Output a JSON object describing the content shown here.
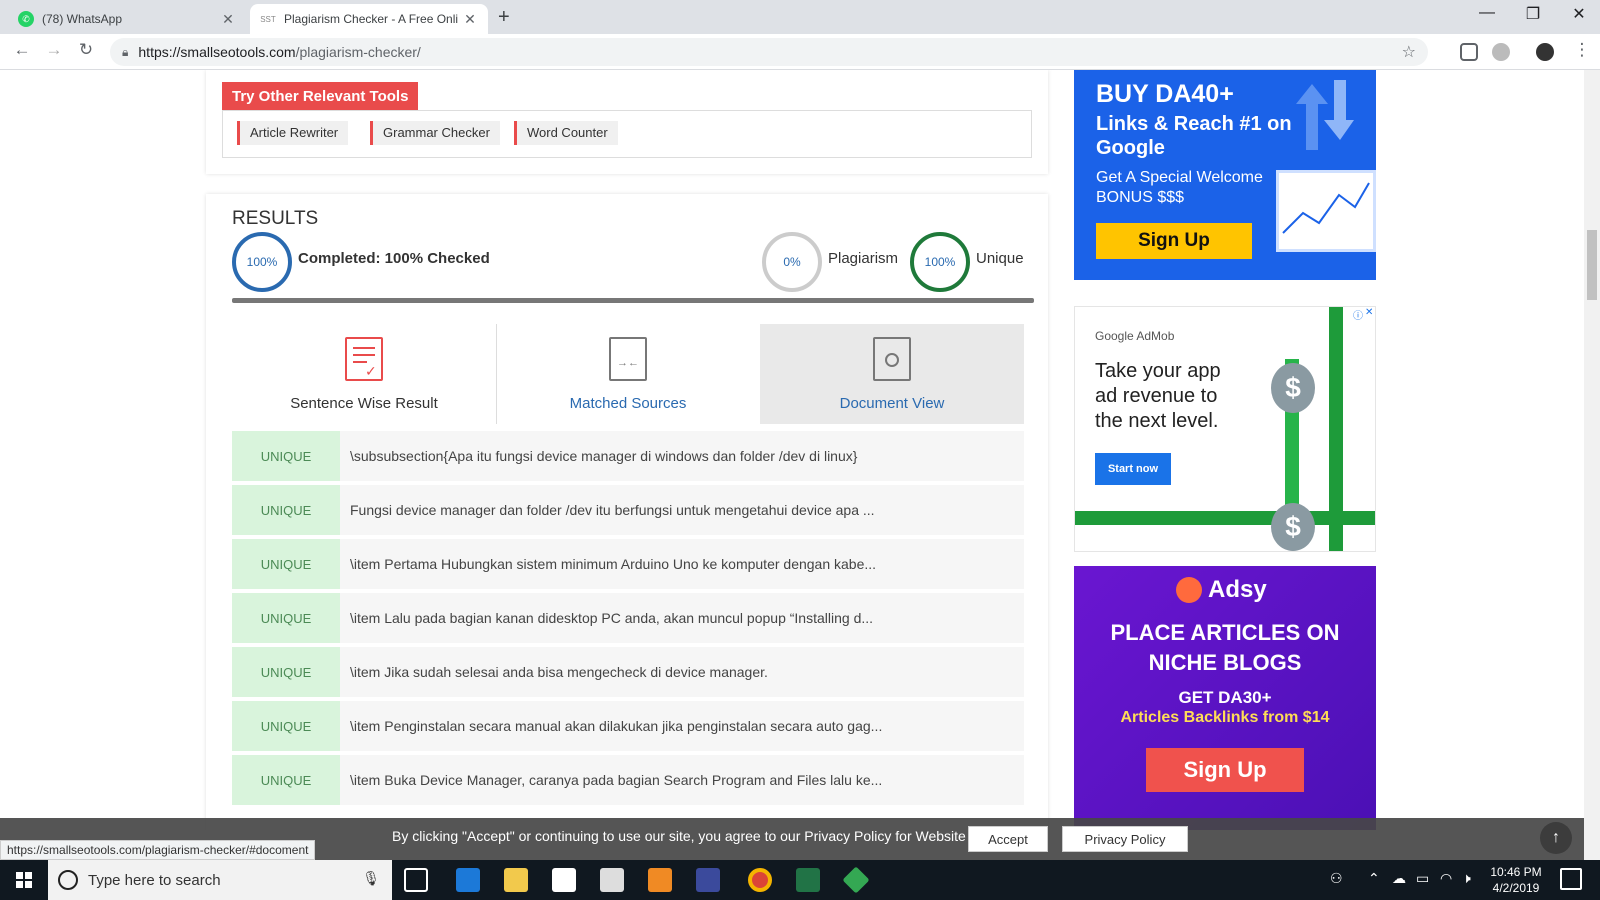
{
  "browser": {
    "tabs": [
      {
        "title": "(78) WhatsApp",
        "active": false
      },
      {
        "title": "Plagiarism Checker - A Free Onli",
        "active": true
      }
    ],
    "url_host": "https://smallseotools.com",
    "url_path": "/plagiarism-checker/",
    "status_url": "https://smallseotools.com/plagiarism-checker/#docoment"
  },
  "tools": {
    "heading": "Try Other Relevant Tools",
    "items": [
      "Article Rewriter",
      "Grammar Checker",
      "Word Counter"
    ]
  },
  "results": {
    "title": "RESULTS",
    "completed_pct": "100%",
    "completed_label": "Completed: 100% Checked",
    "plagiarism_pct": "0%",
    "plagiarism_label": "Plagiarism",
    "unique_pct": "100%",
    "unique_label": "Unique",
    "tabs": [
      "Sentence Wise Result",
      "Matched Sources",
      "Document View"
    ],
    "rows": [
      {
        "status": "UNIQUE",
        "text": "\\subsubsection{Apa itu fungsi device manager di windows dan folder /dev di linux}"
      },
      {
        "status": "UNIQUE",
        "text": "Fungsi device manager dan folder /dev itu berfungsi untuk mengetahui device apa ..."
      },
      {
        "status": "UNIQUE",
        "text": "\\item Pertama Hubungkan sistem minimum Arduino Uno ke komputer dengan kabe..."
      },
      {
        "status": "UNIQUE",
        "text": "\\item Lalu pada bagian kanan didesktop PC anda, akan muncul popup “Installing d..."
      },
      {
        "status": "UNIQUE",
        "text": "\\item Jika sudah selesai anda bisa mengecheck di device manager."
      },
      {
        "status": "UNIQUE",
        "text": "\\item Penginstalan secara manual akan dilakukan jika penginstalan secara auto gag..."
      },
      {
        "status": "UNIQUE",
        "text": "\\item Buka Device Manager, caranya pada bagian Search Program and Files lalu ke..."
      }
    ]
  },
  "ads": {
    "ad1": {
      "line1": "BUY DA40+",
      "line2": "Links & Reach #1 on Google",
      "line3": "Get A Special Welcome BONUS $$$",
      "button": "Sign Up"
    },
    "ad2": {
      "brand": "Google AdMob",
      "headline": "Take your app ad revenue to the next level.",
      "button": "Start now"
    },
    "ad3": {
      "brand": "Adsy",
      "headline": "PLACE ARTICLES ON NICHE BLOGS",
      "sub1": "GET DA30+",
      "sub2": "Articles Backlinks from $14",
      "button": "Sign Up"
    }
  },
  "cookie": {
    "message": "By clicking \"Accept\" or continuing to use our site, you agree to our Privacy Policy for Website",
    "accept": "Accept",
    "policy": "Privacy Policy"
  },
  "taskbar": {
    "search_placeholder": "Type here to search",
    "time": "10:46 PM",
    "date": "4/2/2019"
  },
  "colors": {
    "accent_red": "#e94b4b",
    "unique_green": "#1f7a3a",
    "link_blue": "#2a6ab0"
  }
}
